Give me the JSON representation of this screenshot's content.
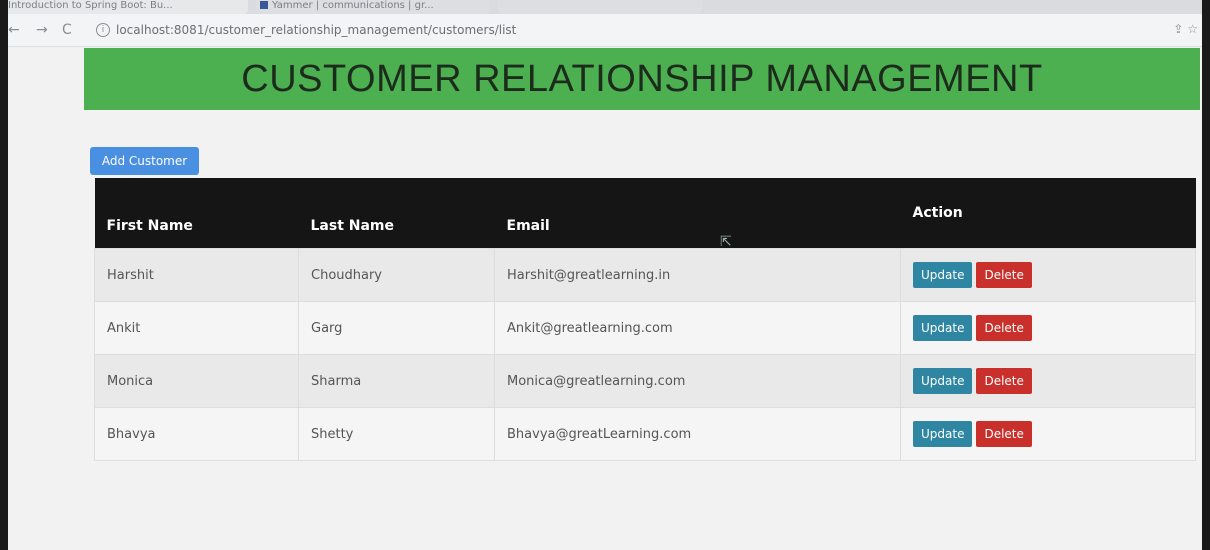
{
  "browser": {
    "tabs": [
      {
        "label": "Introduction to Spring Boot: Bu..."
      },
      {
        "label": "Yammer | communications | gr..."
      },
      {
        "label": ""
      }
    ],
    "url": "localhost:8081/customer_relationship_management/customers/list"
  },
  "page": {
    "title": "CUSTOMER RELATIONSHIP MANAGEMENT",
    "add_button": "Add Customer"
  },
  "table": {
    "headers": [
      "First Name",
      "Last Name",
      "Email",
      "Action"
    ],
    "rows": [
      {
        "first": "Harshit",
        "last": "Choudhary",
        "email": "Harshit@greatlearning.in"
      },
      {
        "first": "Ankit",
        "last": "Garg",
        "email": "Ankit@greatlearning.com"
      },
      {
        "first": "Monica",
        "last": "Sharma",
        "email": "Monica@greatlearning.com"
      },
      {
        "first": "Bhavya",
        "last": "Shetty",
        "email": "Bhavya@greatLearning.com"
      }
    ],
    "update_label": "Update",
    "delete_label": "Delete"
  },
  "colors": {
    "banner": "#4caf50",
    "header": "#151515",
    "add_button": "#4a90e2",
    "update": "#2e86a3",
    "delete": "#c9302c"
  },
  "icons": [
    "back-icon",
    "forward-icon",
    "reload-icon",
    "info-icon",
    "share-icon",
    "star-icon"
  ]
}
